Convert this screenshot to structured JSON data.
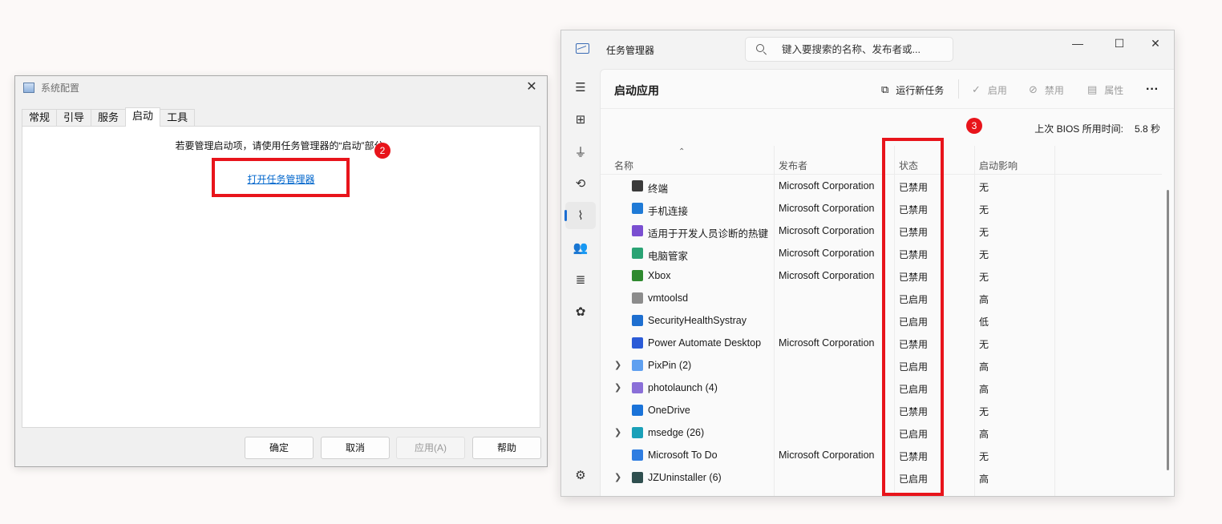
{
  "msconfig": {
    "title": "系统配置",
    "tabs": [
      "常规",
      "引导",
      "服务",
      "启动",
      "工具"
    ],
    "message": "若要管理启动项，请使用任务管理器的“启动”部分。",
    "open_link": "打开任务管理器",
    "annotation_number": "2",
    "buttons": {
      "ok": "确定",
      "cancel": "取消",
      "apply": "应用(A)",
      "help": "帮助"
    }
  },
  "taskmgr": {
    "title": "任务管理器",
    "search_placeholder": "键入要搜索的名称、发布者或...",
    "page_title": "启动应用",
    "commands": {
      "run_new": "运行新任务",
      "enable": "启用",
      "disable": "禁用",
      "properties": "属性"
    },
    "bios_label": "上次 BIOS 所用时间:",
    "bios_value": "5.8 秒",
    "annotation_number": "3",
    "columns": {
      "name": "名称",
      "publisher": "发布者",
      "status": "状态",
      "impact": "启动影响"
    },
    "rows": [
      {
        "name": "终端",
        "publisher": "Microsoft Corporation",
        "status": "已禁用",
        "impact": "无",
        "icon": "terminal-icon",
        "color": "#3a3a3a",
        "expand": false
      },
      {
        "name": "手机连接",
        "publisher": "Microsoft Corporation",
        "status": "已禁用",
        "impact": "无",
        "icon": "phone-link-icon",
        "color": "#1f7ad6",
        "expand": false
      },
      {
        "name": "适用于开发人员诊断的热键",
        "publisher": "Microsoft Corporation",
        "status": "已禁用",
        "impact": "无",
        "icon": "dev-hotkey-icon",
        "color": "#7a4fd1",
        "expand": false
      },
      {
        "name": "电脑管家",
        "publisher": "Microsoft Corporation",
        "status": "已禁用",
        "impact": "无",
        "icon": "pc-manager-icon",
        "color": "#2aa374",
        "expand": false
      },
      {
        "name": "Xbox",
        "publisher": "Microsoft Corporation",
        "status": "已禁用",
        "impact": "无",
        "icon": "xbox-icon",
        "color": "#2f8a2f",
        "expand": false
      },
      {
        "name": "vmtoolsd",
        "publisher": "",
        "status": "已启用",
        "impact": "高",
        "icon": "vmware-icon",
        "color": "#8c8c8c",
        "expand": false
      },
      {
        "name": "SecurityHealthSystray",
        "publisher": "",
        "status": "已启用",
        "impact": "低",
        "icon": "shield-icon",
        "color": "#1e6fd0",
        "expand": false
      },
      {
        "name": "Power Automate Desktop",
        "publisher": "Microsoft Corporation",
        "status": "已禁用",
        "impact": "无",
        "icon": "power-automate-icon",
        "color": "#2b5bd7",
        "expand": false
      },
      {
        "name": "PixPin (2)",
        "publisher": "",
        "status": "已启用",
        "impact": "高",
        "icon": "pixpin-icon",
        "color": "#5fa0f0",
        "expand": true
      },
      {
        "name": "photolaunch (4)",
        "publisher": "",
        "status": "已启用",
        "impact": "高",
        "icon": "photolaunch-icon",
        "color": "#8a6fd8",
        "expand": true
      },
      {
        "name": "OneDrive",
        "publisher": "",
        "status": "已禁用",
        "impact": "无",
        "icon": "onedrive-icon",
        "color": "#1a73d9",
        "expand": false
      },
      {
        "name": "msedge (26)",
        "publisher": "",
        "status": "已启用",
        "impact": "高",
        "icon": "edge-icon",
        "color": "#1aa0b8",
        "expand": true
      },
      {
        "name": "Microsoft To Do",
        "publisher": "Microsoft Corporation",
        "status": "已禁用",
        "impact": "无",
        "icon": "todo-icon",
        "color": "#2f7de1",
        "expand": false
      },
      {
        "name": "JZUninstaller (6)",
        "publisher": "",
        "status": "已启用",
        "impact": "高",
        "icon": "jzuninstaller-icon",
        "color": "#2f4f4f",
        "expand": true
      }
    ],
    "accent_color": "#1c6ed2",
    "annotation_color": "#e8141b"
  }
}
